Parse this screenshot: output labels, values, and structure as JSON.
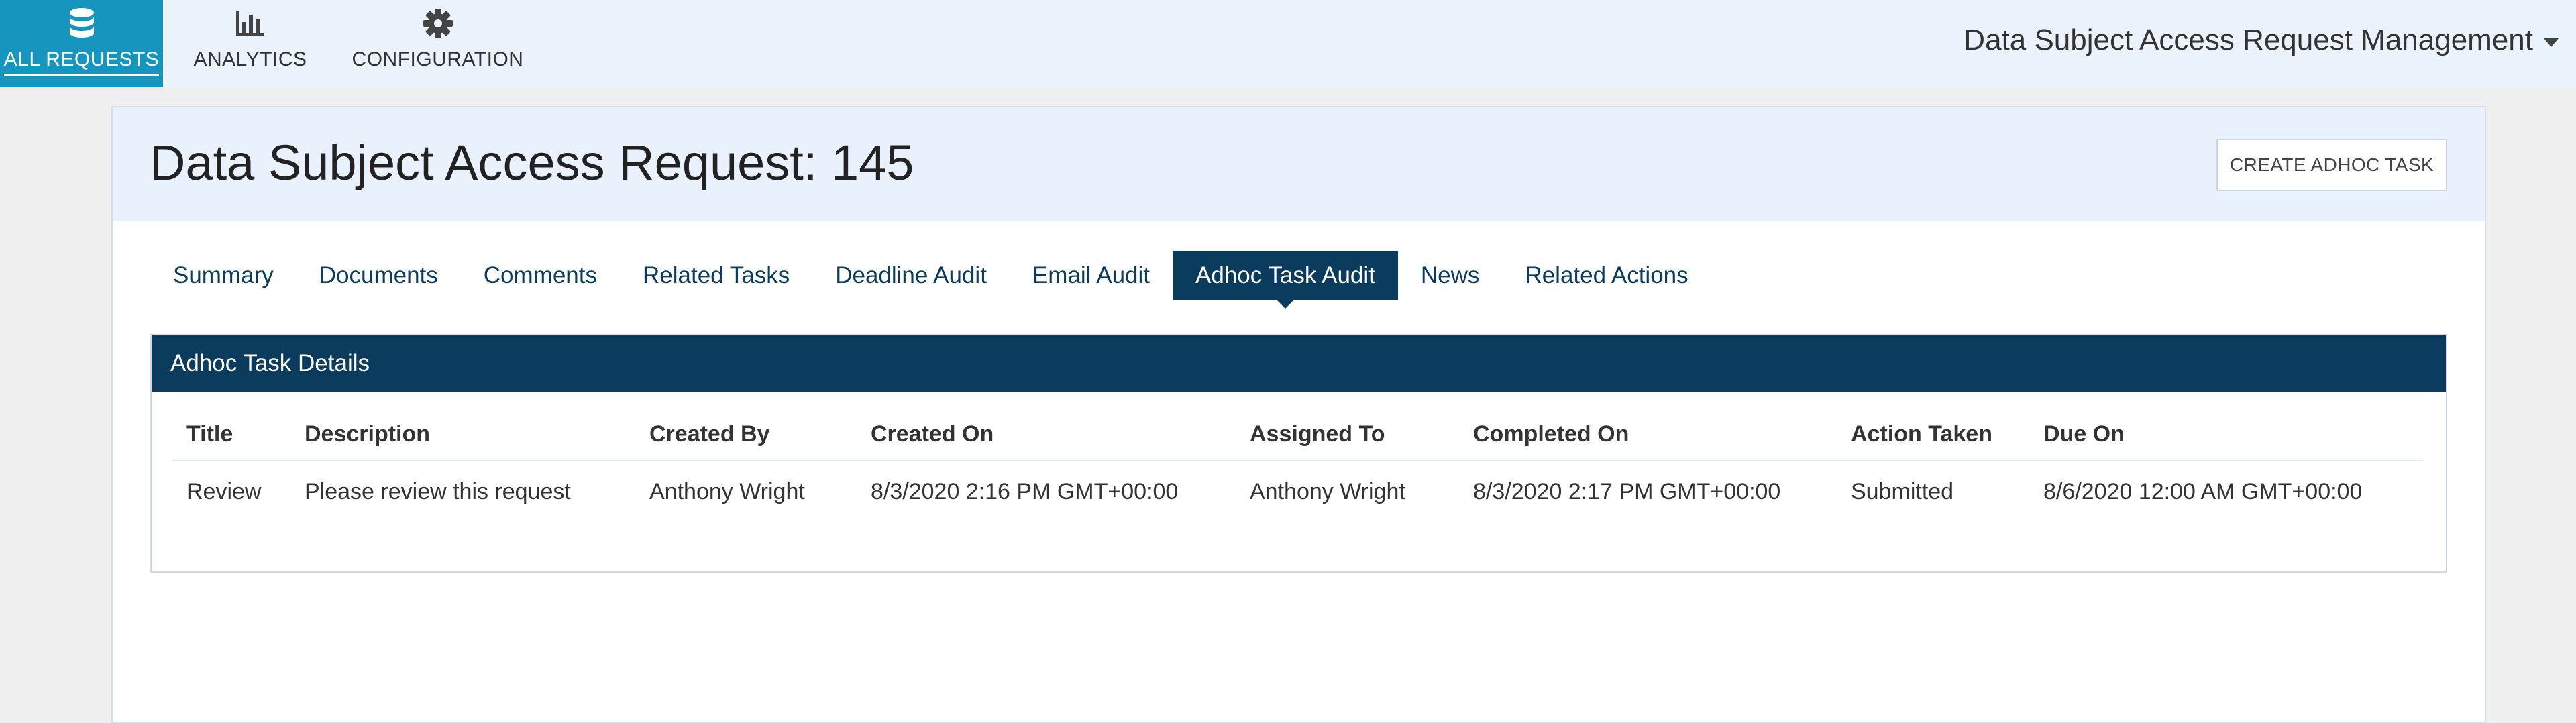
{
  "nav": {
    "items": [
      {
        "label": "ALL REQUESTS",
        "icon": "database-icon",
        "active": true
      },
      {
        "label": "ANALYTICS",
        "icon": "bar-chart-icon",
        "active": false
      },
      {
        "label": "CONFIGURATION",
        "icon": "gear-icon",
        "active": false
      }
    ],
    "app_title": "Data Subject Access Request Management"
  },
  "page": {
    "title": "Data Subject Access Request: 145",
    "create_button": "CREATE ADHOC TASK"
  },
  "tabs": [
    {
      "label": "Summary"
    },
    {
      "label": "Documents"
    },
    {
      "label": "Comments"
    },
    {
      "label": "Related Tasks"
    },
    {
      "label": "Deadline Audit"
    },
    {
      "label": "Email Audit"
    },
    {
      "label": "Adhoc Task Audit",
      "active": true
    },
    {
      "label": "News"
    },
    {
      "label": "Related Actions"
    }
  ],
  "details": {
    "heading": "Adhoc Task Details",
    "columns": [
      "Title",
      "Description",
      "Created By",
      "Created On",
      "Assigned To",
      "Completed On",
      "Action Taken",
      "Due On"
    ],
    "rows": [
      [
        "Review",
        "Please review this request",
        "Anthony Wright",
        "8/3/2020 2:16 PM GMT+00:00",
        "Anthony Wright",
        "8/3/2020 2:17 PM GMT+00:00",
        "Submitted",
        "8/6/2020 12:00 AM GMT+00:00"
      ]
    ]
  },
  "colors": {
    "nav_active": "#1696be",
    "header_bg": "#eaf2fc",
    "tab_active": "#0b3c5d",
    "tab_text": "#0a3c5f"
  }
}
